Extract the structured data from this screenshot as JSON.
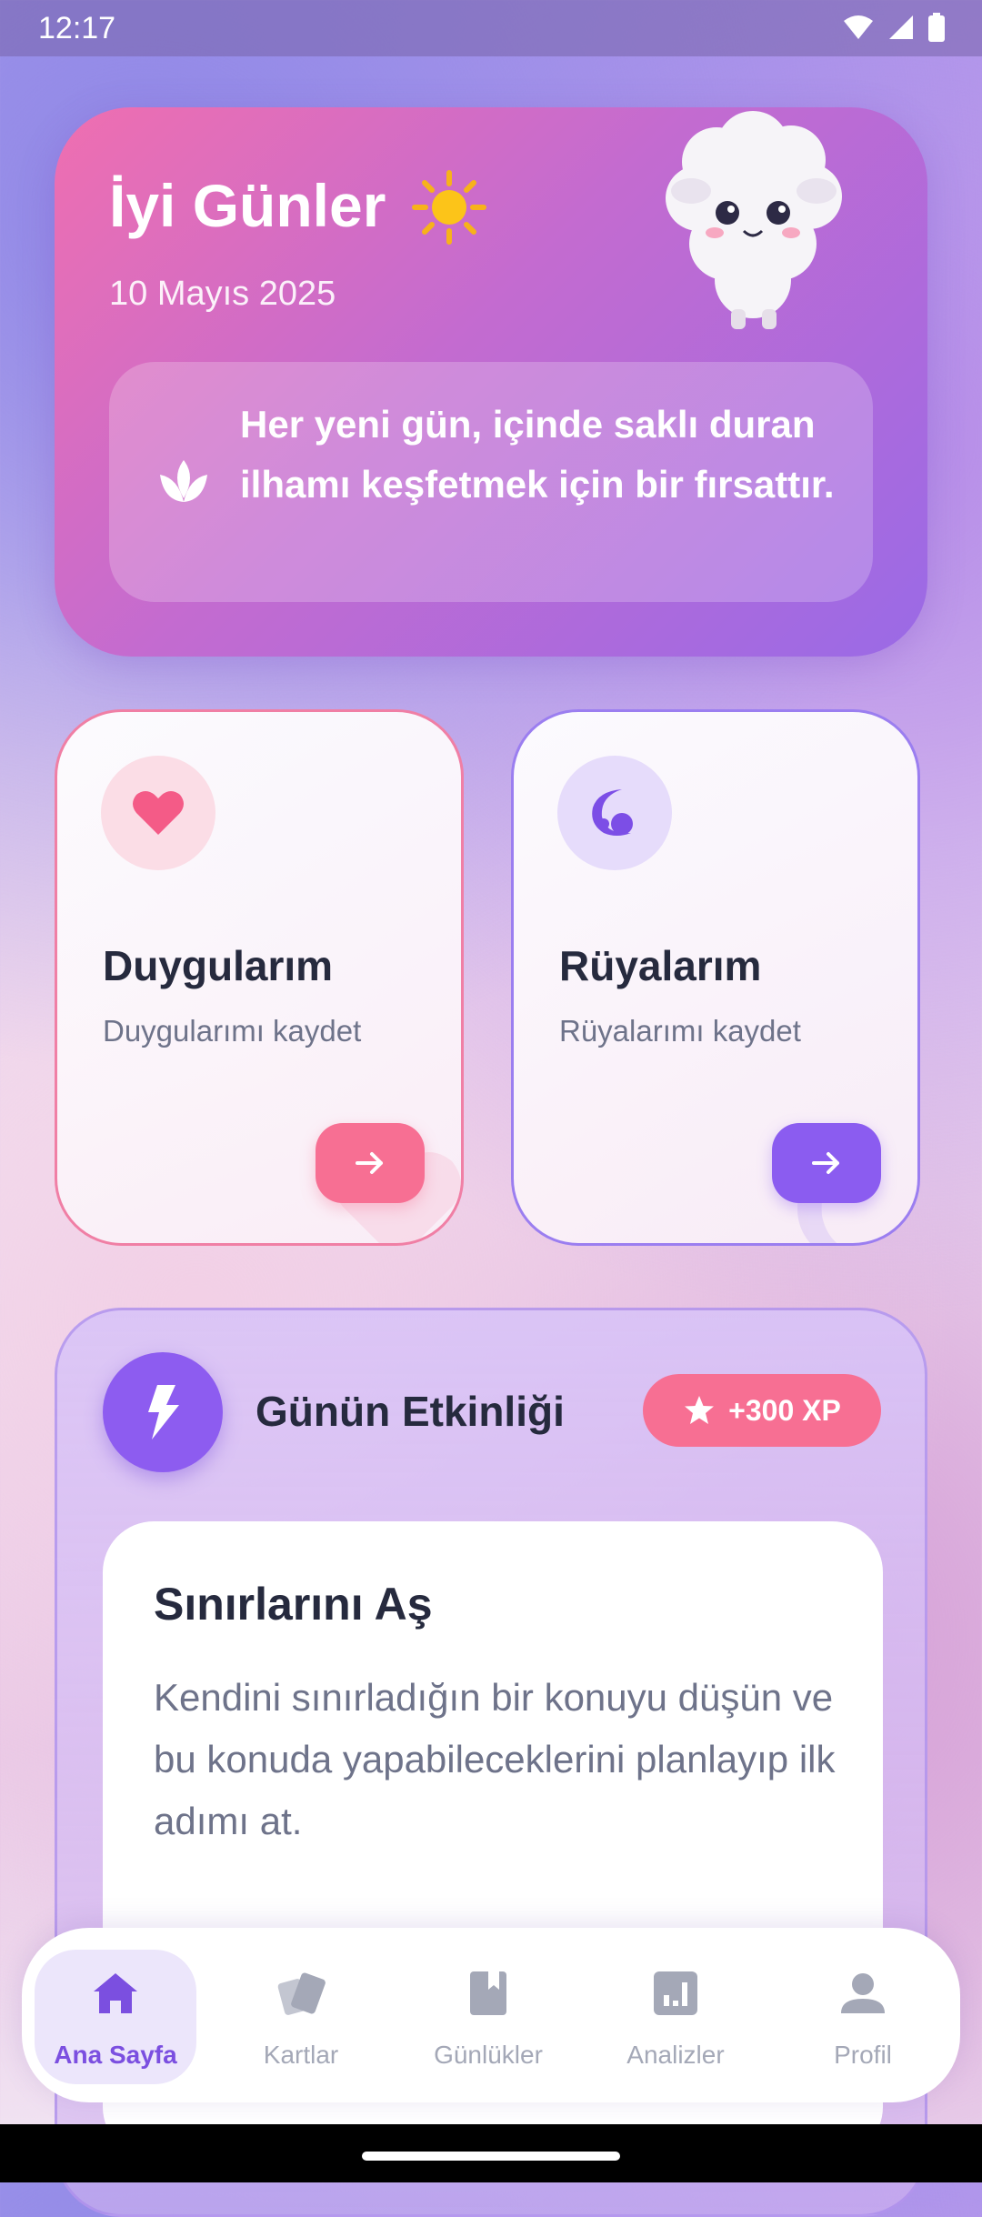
{
  "status_bar": {
    "time": "12:17"
  },
  "hero": {
    "greeting": "İyi Günler",
    "date": "10 Mayıs 2025",
    "quote": "Her yeni gün, içinde saklı duran ilhamı keşfetmek için bir fırsattır."
  },
  "cards": [
    {
      "title": "Duygularım",
      "subtitle": "Duygularımı kaydet",
      "icon": "heart-icon",
      "accent": "#f76f93"
    },
    {
      "title": "Rüyalarım",
      "subtitle": "Rüyalarımı kaydet",
      "icon": "moon-icon",
      "accent": "#8b5cf0"
    }
  ],
  "activity": {
    "title": "Günün Etkinliği",
    "xp_badge": "+300 XP",
    "task_title": "Sınırlarını Aş",
    "task_description": "Kendini sınırladığın bir konuyu düşün ve bu konuda yapabileceklerini planlayıp ilk adımı at."
  },
  "bottom_nav": {
    "items": [
      {
        "label": "Ana Sayfa",
        "icon": "home-icon",
        "active": true
      },
      {
        "label": "Kartlar",
        "icon": "cards-icon",
        "active": false
      },
      {
        "label": "Günlükler",
        "icon": "book-icon",
        "active": false
      },
      {
        "label": "Analizler",
        "icon": "analytics-icon",
        "active": false
      },
      {
        "label": "Profil",
        "icon": "person-icon",
        "active": false
      }
    ]
  },
  "colors": {
    "pink": "#f76f93",
    "purple": "#8b5cf0",
    "text_dark": "#262a3e",
    "text_muted": "#6e738a"
  }
}
